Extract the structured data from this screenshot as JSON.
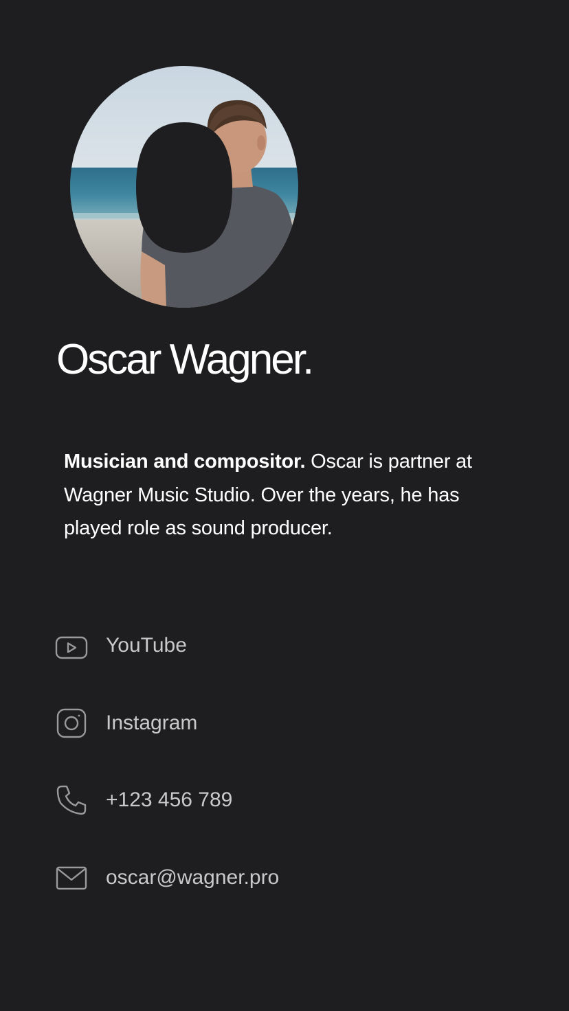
{
  "profile": {
    "name": "Oscar Wagner.",
    "bio_lead": "Musician and compositor.",
    "bio_text": " Oscar is partner at Wagner Music Studio. Over the years, he has played role as sound producer."
  },
  "contacts": [
    {
      "icon": "youtube-icon",
      "label": "YouTube"
    },
    {
      "icon": "instagram-icon",
      "label": "Instagram"
    },
    {
      "icon": "phone-icon",
      "label": "+123 456 789"
    },
    {
      "icon": "mail-icon",
      "label": "oscar@wagner.pro"
    }
  ],
  "colors": {
    "background": "#1e1e20",
    "text": "#ffffff",
    "muted_text": "#c9c9cb",
    "icon": "#9a9a9d"
  }
}
